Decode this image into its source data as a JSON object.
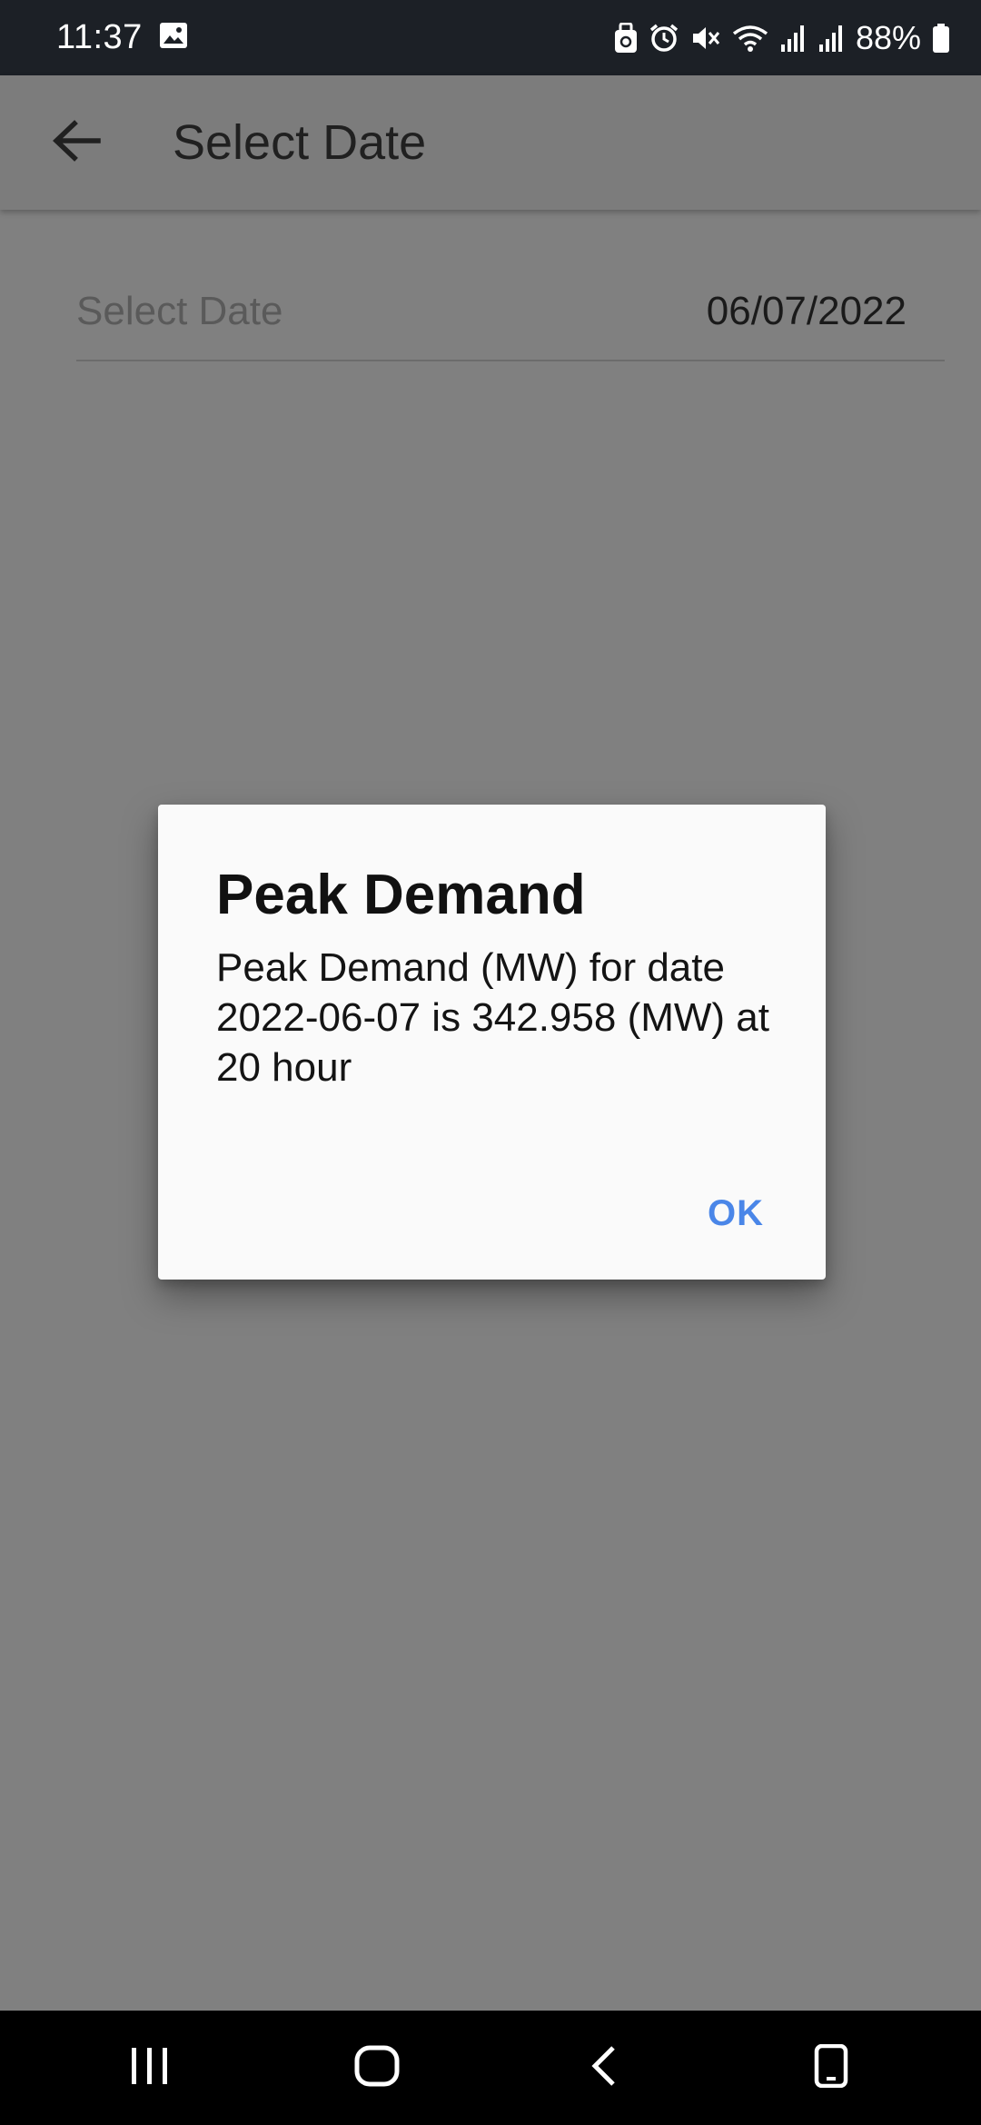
{
  "status_bar": {
    "time": "11:37",
    "battery": "88%"
  },
  "app_bar": {
    "title": "Select Date",
    "back_icon": "arrow-left-icon"
  },
  "form": {
    "date_label": "Select Date",
    "date_value": "06/07/2022"
  },
  "dialog": {
    "title": "Peak Demand",
    "message": "Peak Demand (MW) for date 2022-06-07 is 342.958 (MW) at 20 hour",
    "ok_label": "OK",
    "accent_color": "#4a86e8"
  },
  "nav_bar": {
    "recents_icon": "recents-icon",
    "home_icon": "home-icon",
    "back_icon": "back-chevron-icon",
    "extra_icon": "phone-icon"
  }
}
